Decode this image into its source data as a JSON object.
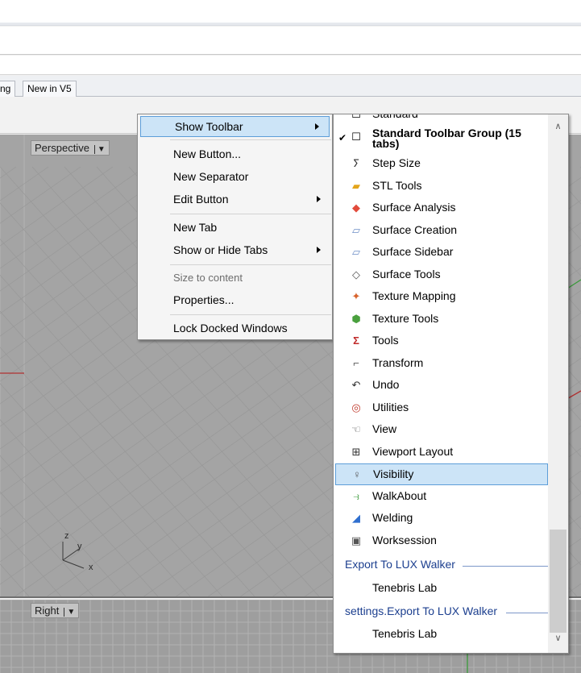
{
  "ribbon_tabs": [
    "ng",
    "New in V5"
  ],
  "viewports": {
    "top_label": "Perspective",
    "bottom_label": "Right",
    "axis_labels": [
      "z",
      "y",
      "x"
    ]
  },
  "context_menu": {
    "items": [
      {
        "label": "Show Toolbar",
        "submenu": true
      },
      {
        "label": "New Button...",
        "submenu": false
      },
      {
        "label": "New Separator",
        "submenu": false
      },
      {
        "label": "Edit Button",
        "submenu": true
      },
      {
        "label": "New Tab",
        "submenu": false
      },
      {
        "label": "Show or Hide Tabs",
        "submenu": true
      },
      {
        "label": "Size to content",
        "submenu": false
      },
      {
        "label": "Properties...",
        "submenu": false
      },
      {
        "label": "Lock Docked Windows",
        "submenu": false
      }
    ]
  },
  "toolbar_list": {
    "partial_top": "Standard",
    "checked_item": "Standard Toolbar Group (15 tabs)",
    "items": [
      {
        "label": "Step Size",
        "icon": "step-size-icon"
      },
      {
        "label": "STL Tools",
        "icon": "folder-icon"
      },
      {
        "label": "Surface Analysis",
        "icon": "surface-analysis-icon"
      },
      {
        "label": "Surface Creation",
        "icon": "surface-creation-icon"
      },
      {
        "label": "Surface Sidebar",
        "icon": "surface-sidebar-icon"
      },
      {
        "label": "Surface Tools",
        "icon": "surface-tools-icon"
      },
      {
        "label": "Texture Mapping",
        "icon": "texture-mapping-icon"
      },
      {
        "label": "Texture Tools",
        "icon": "texture-tools-icon"
      },
      {
        "label": "Tools",
        "icon": "tools-icon"
      },
      {
        "label": "Transform",
        "icon": "transform-icon"
      },
      {
        "label": "Undo",
        "icon": "undo-icon"
      },
      {
        "label": "Utilities",
        "icon": "utilities-icon"
      },
      {
        "label": "View",
        "icon": "view-icon"
      },
      {
        "label": "Viewport Layout",
        "icon": "viewport-layout-icon"
      },
      {
        "label": "Visibility",
        "icon": "visibility-icon"
      },
      {
        "label": "WalkAbout",
        "icon": "walkabout-icon"
      },
      {
        "label": "Welding",
        "icon": "welding-icon"
      },
      {
        "label": "Worksession",
        "icon": "worksession-icon"
      }
    ],
    "selected_item": "Visibility",
    "groups": [
      {
        "header": "Export To LUX Walker",
        "items": [
          "Tenebris Lab"
        ]
      },
      {
        "header": "settings.Export To LUX Walker",
        "items": [
          "Tenebris Lab"
        ]
      }
    ]
  },
  "colors": {
    "highlight": "#cce4f7",
    "highlight_border": "#5d9ed9",
    "group_header": "#1c3f8f",
    "viewport": "#a4a4a4"
  }
}
